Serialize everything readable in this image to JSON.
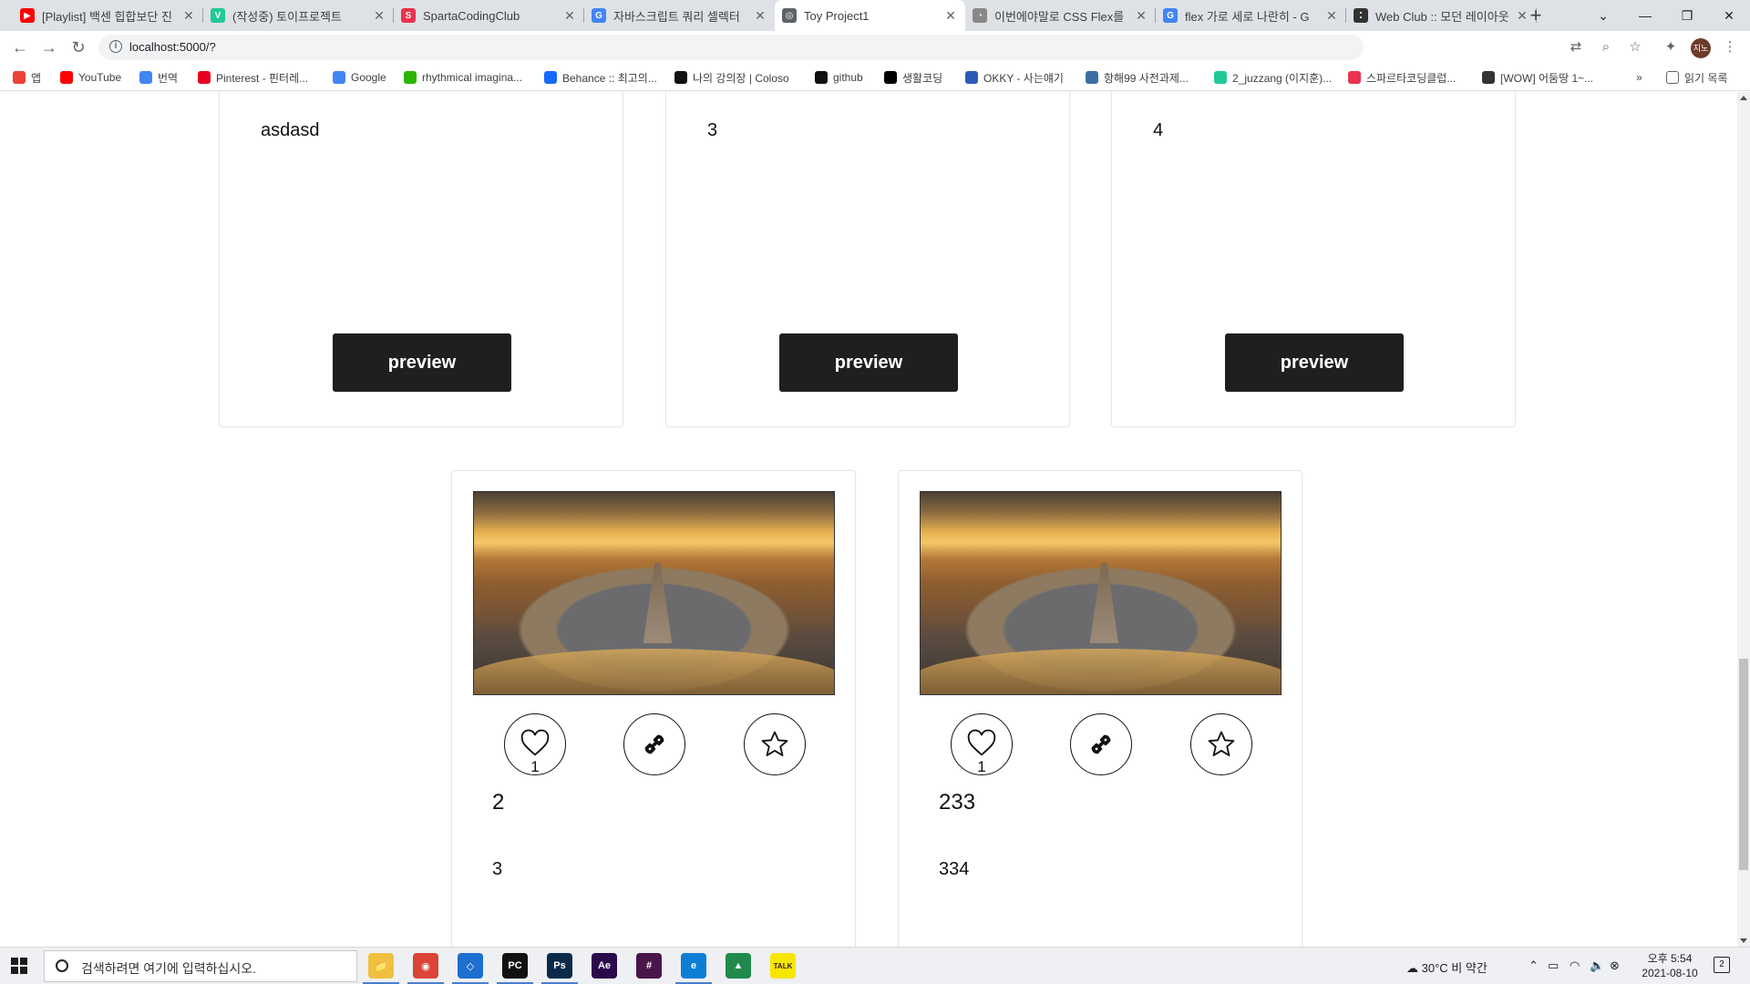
{
  "browser": {
    "tabs": [
      {
        "title": "[Playlist] 백센 힙합보단 진",
        "icon_color": "#ff0000",
        "icon_text": "▶"
      },
      {
        "title": "(작성중) 토이프로젝트",
        "icon_color": "#20c997",
        "icon_text": "V"
      },
      {
        "title": "SpartaCodingClub",
        "icon_color": "#e8344e",
        "icon_text": "S"
      },
      {
        "title": "자바스크립트 쿼리 셀렉터",
        "icon_color": "#4285f4",
        "icon_text": "G"
      },
      {
        "title": "Toy Project1",
        "icon_color": "#5f6368",
        "icon_text": "◎"
      },
      {
        "title": "이번에야말로 CSS Flex를",
        "icon_color": "#888888",
        "icon_text": "◔"
      },
      {
        "title": "flex 가로 세로 나란히 - G",
        "icon_color": "#4285f4",
        "icon_text": "G"
      },
      {
        "title": "Web Club :: 모던 레이아웃",
        "icon_color": "#333333",
        "icon_text": "⁚"
      }
    ],
    "active_tab_index": 4,
    "url": "localhost:5000/?",
    "bookmarks": [
      {
        "label": "앱",
        "color": "#ea4335"
      },
      {
        "label": "YouTube",
        "color": "#ff0000"
      },
      {
        "label": "번역",
        "color": "#4285f4"
      },
      {
        "label": "Pinterest - 핀터레...",
        "color": "#e60023"
      },
      {
        "label": "Google",
        "color": "#4285f4"
      },
      {
        "label": "rhythmical imagina...",
        "color": "#2db400"
      },
      {
        "label": "Behance :: 최고의...",
        "color": "#1769ff"
      },
      {
        "label": "나의 강의장 | Coloso",
        "color": "#111111"
      },
      {
        "label": "github",
        "color": "#111111"
      },
      {
        "label": "생활코딩",
        "color": "#000000"
      },
      {
        "label": "OKKY - 사는얘기",
        "color": "#2b5bb8"
      },
      {
        "label": "항해99 사전과제...",
        "color": "#3a6ea5"
      },
      {
        "label": "2_juzzang (이지훈)...",
        "color": "#20c997"
      },
      {
        "label": "스파르타코딩클럽...",
        "color": "#e8344e"
      },
      {
        "label": "[WOW] 어둠땅 1~...",
        "color": "#333333"
      }
    ],
    "bookmarks_more": "»",
    "reading_list": "읽기 목록",
    "profile_initials": "지노"
  },
  "page": {
    "top_cards": [
      {
        "text": "asdasd",
        "button": "preview"
      },
      {
        "text": "3",
        "button": "preview"
      },
      {
        "text": "4",
        "button": "preview"
      }
    ],
    "image_cards": [
      {
        "like_count": "1",
        "title": "2",
        "body": "3"
      },
      {
        "like_count": "1",
        "title": "233",
        "body": "334"
      }
    ]
  },
  "taskbar": {
    "search_placeholder": "검색하려면 여기에 입력하십시오.",
    "apps": [
      {
        "name": "file-explorer",
        "color": "#f0c040",
        "label": "📁"
      },
      {
        "name": "chrome",
        "color": "#db4437",
        "label": "◉"
      },
      {
        "name": "vscode",
        "color": "#1e6fcf",
        "label": "◇"
      },
      {
        "name": "pycharm",
        "color": "#111111",
        "label": "PC"
      },
      {
        "name": "photoshop",
        "color": "#0b2a4a",
        "label": "Ps"
      },
      {
        "name": "after-effects",
        "color": "#2a0a4a",
        "label": "Ae"
      },
      {
        "name": "slack",
        "color": "#4a154b",
        "label": "#"
      },
      {
        "name": "edge",
        "color": "#0c7ed6",
        "label": "e"
      },
      {
        "name": "sourcetree",
        "color": "#1f8a4c",
        "label": "▲"
      },
      {
        "name": "kakaotalk",
        "color": "#f7e600",
        "label": "TALK"
      }
    ],
    "weather": "30°C  비 약간",
    "time": "오후 5:54",
    "date": "2021-08-10",
    "notifications": "2"
  }
}
